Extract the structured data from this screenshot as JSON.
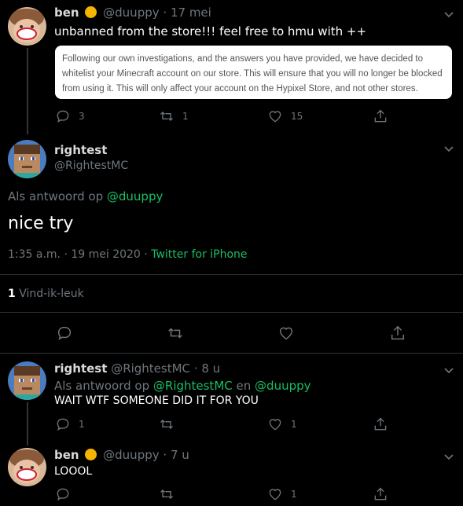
{
  "tweet1": {
    "name": "ben",
    "handle": "@duuppy",
    "dot": "·",
    "date": "17 mei",
    "text": "unbanned from the store!!! feel free to hmu with ++",
    "quote": "Following our own investigations, and the answers you have provided, we have decided to whitelist your Minecraft account on our store. This will ensure that you will no longer be blocked from using it. This will only affect your account on the Hypixel Store, and not other stores.",
    "replies": "3",
    "retweets": "1",
    "likes": "15"
  },
  "main": {
    "name": "rightest",
    "handle": "@RightestMC",
    "reply_prefix": "Als antwoord op",
    "reply_to": "@duuppy",
    "text": "nice try",
    "time": "1:35 a.m. · 19 mei 2020",
    "source_sep": "·",
    "source": "Twitter for iPhone",
    "likes_count": "1",
    "likes_label": "Vind-ik-leuk"
  },
  "reply1": {
    "name": "rightest",
    "handle": "@RightestMC",
    "dot": "·",
    "age": "8 u",
    "reply_prefix": "Als antwoord op",
    "reply_to_1": "@RightestMC",
    "and": "en",
    "reply_to_2": "@duuppy",
    "text": "WAIT WTF SOMEONE DID IT FOR YOU",
    "replies": "1",
    "likes": "1"
  },
  "reply2": {
    "name": "ben",
    "handle": "@duuppy",
    "dot": "·",
    "age": "7 u",
    "text": "LOOOL",
    "likes": "1"
  },
  "colors": {
    "background": "#000000",
    "text": "#d9d9d9",
    "muted": "#6e767d",
    "link": "#17bf63",
    "separator": "#2f3336"
  }
}
